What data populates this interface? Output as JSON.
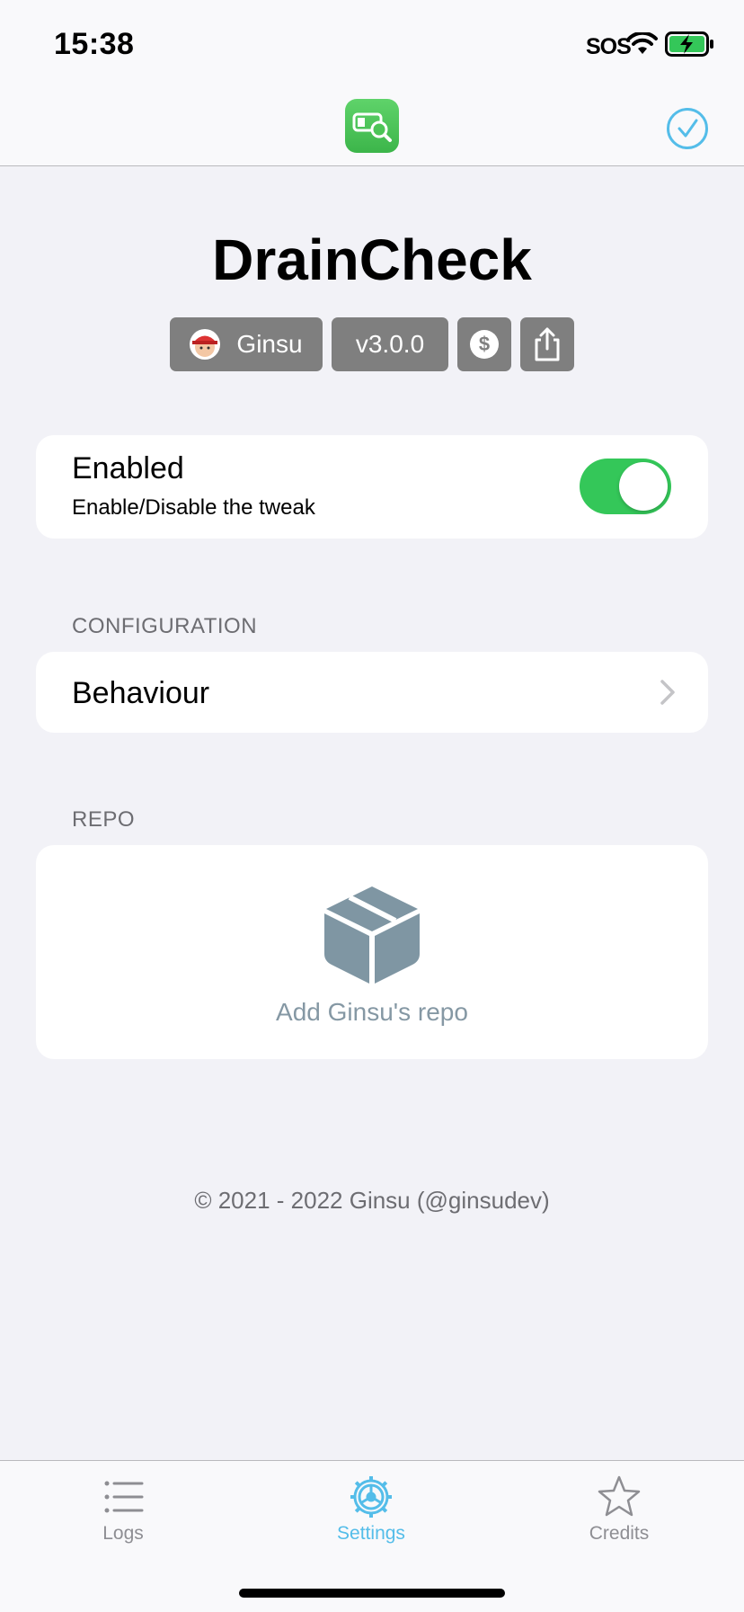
{
  "status_bar": {
    "time": "15:38",
    "sos": "SOS"
  },
  "nav": {
    "app_icon": "search-battery-icon",
    "confirm_icon": "checkmark-circle-icon"
  },
  "header": {
    "title": "DrainCheck",
    "author": "Ginsu",
    "version": "v3.0.0",
    "donate_icon": "dollar-icon",
    "share_icon": "share-icon"
  },
  "enabled": {
    "title": "Enabled",
    "subtitle": "Enable/Disable the tweak",
    "state": true
  },
  "configuration": {
    "header": "CONFIGURATION",
    "behaviour_label": "Behaviour"
  },
  "repo": {
    "header": "REPO",
    "add_label": "Add Ginsu's repo",
    "icon": "package-icon"
  },
  "footer": {
    "copyright": "© 2021 - 2022 Ginsu (@ginsudev)"
  },
  "tabs": [
    {
      "label": "Logs",
      "icon": "list-icon",
      "selected": false
    },
    {
      "label": "Settings",
      "icon": "gear-icon",
      "selected": true
    },
    {
      "label": "Credits",
      "icon": "star-icon",
      "selected": false
    }
  ],
  "colors": {
    "accent": "#54bde9",
    "toggle_on": "#34c759",
    "pill": "#7f7f7f",
    "repo_icon": "#7f96a3"
  }
}
